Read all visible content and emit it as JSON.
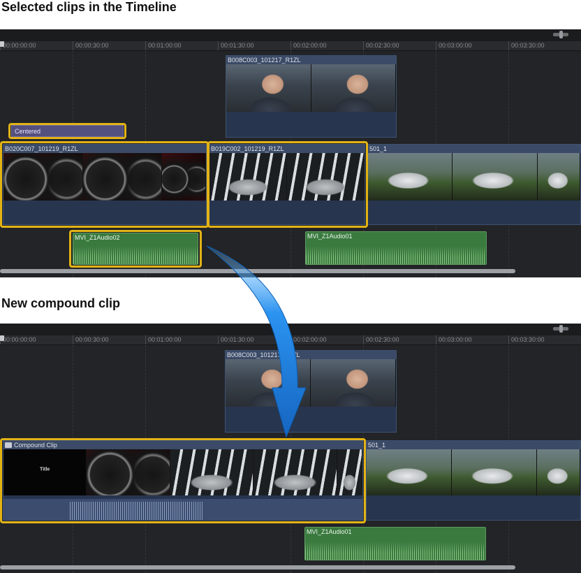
{
  "headings": {
    "top": "Selected clips in the Timeline",
    "bottom": "New compound clip"
  },
  "ruler": {
    "top_ticks": [
      "00:00:00:00",
      "00:00:30:00",
      "00:01:00:00",
      "00:01:30:00",
      "00:02:00:00",
      "00:02:30:00",
      "00:03:00:00",
      "00:03:30:00"
    ],
    "bottom_ticks": [
      "00:00:00:00",
      "00:00:30:00",
      "00:01:00:00",
      "00:01:30:00",
      "00:02:00:00",
      "00:02:30:00",
      "00:03:00:00",
      "00:03:30:00"
    ]
  },
  "clips": {
    "connected_top": "B008C003_101217_R1ZL",
    "title_clip": "Centered",
    "primary_1": "B020C007_101219_R1ZL",
    "primary_2": "B019C002_101219_R1ZL",
    "primary_3": "501_1",
    "audio_1": "MVI_Z1Audio02",
    "audio_2": "MVI_Z1Audio01",
    "connected_bottom": "B008C003_101217_R1ZL",
    "compound": "Compound Clip",
    "primary_3_bottom": "501_1",
    "audio_bottom": "MVI_Z1Audio01",
    "title_frame_text": "Title"
  },
  "colors": {
    "selection": "#e2b315",
    "arrow": "#1e88e5",
    "timeline_bg": "#232427",
    "video_clip": "#27354f",
    "audio_clip": "#3a7a3f",
    "title_clip": "#54507e"
  },
  "icons": {
    "arrow": "curved-arrow-down-icon",
    "compound": "compound-clip-icon",
    "zoom": "zoom-slider-icon"
  }
}
